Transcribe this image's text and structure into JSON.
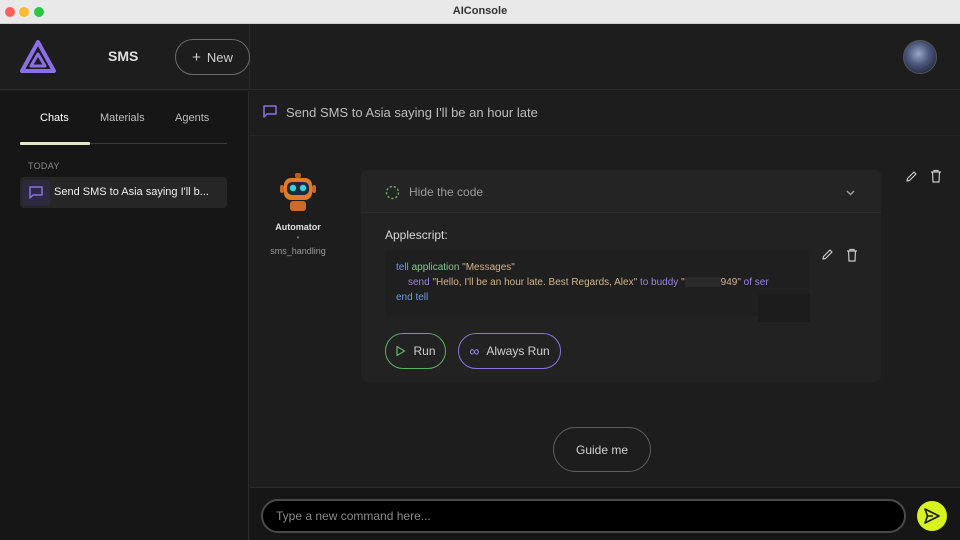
{
  "window": {
    "title": "AIConsole"
  },
  "header": {
    "project_name": "SMS",
    "new_button_label": "New",
    "logo_icon": "triangle-logo-icon",
    "avatar_icon": "user-avatar"
  },
  "sidebar": {
    "tabs": [
      {
        "label": "Chats",
        "active": true
      },
      {
        "label": "Materials",
        "active": false
      },
      {
        "label": "Agents",
        "active": false
      }
    ],
    "section_label": "TODAY",
    "chats": [
      {
        "label": "Send SMS to Asia saying I'll b...",
        "selected": true
      }
    ]
  },
  "chat": {
    "title": "Send SMS to Asia saying I'll be an hour late"
  },
  "message": {
    "agent_name": "Automator",
    "agent_separator": "•",
    "agent_subtitle": "sms_handling",
    "hide_code_label": "Hide the code",
    "language_label": "Applescript:",
    "code": {
      "line1_kw1": "tell",
      "line1_kw2": "application",
      "line1_str": "\"Messages\"",
      "line2_kw": "send",
      "line2_str": "\"Hello, I'll be an hour late. Best Regards, Alex\"",
      "line2_kw2": "to buddy",
      "line2_str2_start": "\"",
      "line2_str2_end": "949\"",
      "line2_kw3": "of ser",
      "line3": "end tell"
    },
    "run_label": "Run",
    "always_run_label": "Always Run"
  },
  "guide_button_label": "Guide me",
  "input": {
    "placeholder": "Type a new command here..."
  },
  "colors": {
    "accent_purple": "#8a72e0",
    "run_green": "#5fae62",
    "send_yellow": "#d7f21d"
  }
}
